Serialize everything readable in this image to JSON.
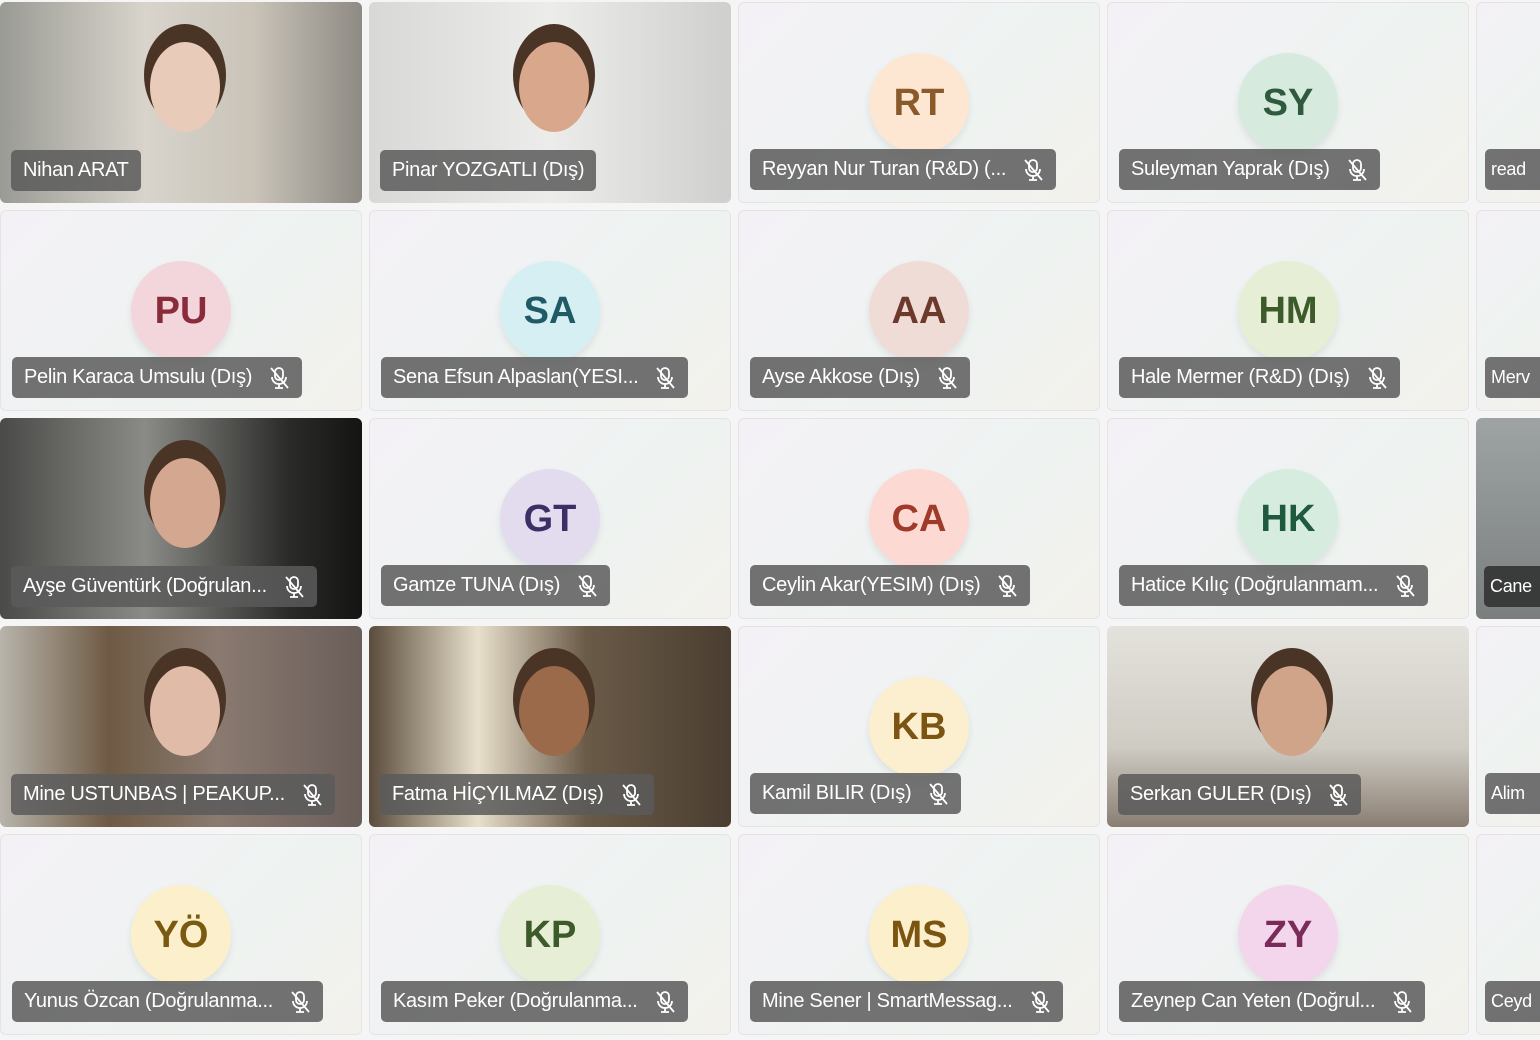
{
  "participants": [
    {
      "name": "Nihan ARAT",
      "type": "video",
      "muted": false,
      "bg": "linear-gradient(90deg,#9a9a94,#d8d4cc 40%,#c9c3b8 70%,#8e8a84)",
      "face": "#e8cbb8"
    },
    {
      "name": "Pinar YOZGATLI (Dış)",
      "type": "video",
      "muted": false,
      "bg": "linear-gradient(90deg,#d8d8d6,#ececea 50%,#cfcfcd)",
      "face": "#d9a88c"
    },
    {
      "name": "Reyyan Nur Turan (R&D) (...",
      "initials": "RT",
      "avatar_bg": "#fde7d3",
      "avatar_fg": "#8a5a2b",
      "muted": true
    },
    {
      "name": "Suleyman Yaprak (Dış)",
      "initials": "SY",
      "avatar_bg": "#d6eadd",
      "avatar_fg": "#2f5a3e",
      "muted": true
    },
    {
      "name": "read",
      "type": "blank",
      "muted": false
    },
    {
      "name": "Pelin Karaca Umsulu (Dış)",
      "initials": "PU",
      "avatar_bg": "#f3d6dc",
      "avatar_fg": "#8a2b3b",
      "muted": true
    },
    {
      "name": "Sena Efsun Alpaslan(YESI...",
      "initials": "SA",
      "avatar_bg": "#d6eff3",
      "avatar_fg": "#1f5a66",
      "muted": true
    },
    {
      "name": "Ayse Akkose (Dış)",
      "initials": "AA",
      "avatar_bg": "#f0dcd6",
      "avatar_fg": "#6b3a2b",
      "muted": true
    },
    {
      "name": "Hale Mermer (R&D) (Dış)",
      "initials": "HM",
      "avatar_bg": "#e6efd6",
      "avatar_fg": "#3d5a2a",
      "muted": true
    },
    {
      "name": "Merv",
      "type": "blank",
      "muted": false
    },
    {
      "name": "Ayşe Güventürk (Doğrulan...",
      "type": "video",
      "muted": true,
      "bg": "linear-gradient(90deg,#4a4a48,#8a8a86 40%,#2a2a28 80%,#141412)",
      "face": "#d4a890"
    },
    {
      "name": "Gamze TUNA (Dış)",
      "initials": "GT",
      "avatar_bg": "#e3dcef",
      "avatar_fg": "#3c2f66",
      "muted": true
    },
    {
      "name": "Ceylin Akar(YESIM) (Dış)",
      "initials": "CA",
      "avatar_bg": "#fcd9d3",
      "avatar_fg": "#a03a2a",
      "muted": true
    },
    {
      "name": "Hatice Kılıç (Doğrulanmam...",
      "initials": "HK",
      "avatar_bg": "#d6ecdf",
      "avatar_fg": "#1f5a3e",
      "muted": true
    },
    {
      "name": "Cane",
      "type": "video",
      "muted": false,
      "bg": "linear-gradient(180deg,#9ea3a3,#7a7e7e)"
    },
    {
      "name": "Mine USTUNBAS | PEAKUP...",
      "type": "video",
      "muted": true,
      "bg": "linear-gradient(90deg,#b8b4ac,#6e5a44 30%,#8a7a70 60%,#6a5e5a)",
      "face": "#e0bca8"
    },
    {
      "name": "Fatma HİÇYILMAZ (Dış)",
      "type": "video",
      "muted": true,
      "bg": "linear-gradient(90deg,#5a4c3c,#e8e0cc 30%,#6a5a48 60%,#4a3e30)",
      "face": "#9a6a4a"
    },
    {
      "name": "Kamil BILIR (Dış)",
      "initials": "KB",
      "avatar_bg": "#fbefcf",
      "avatar_fg": "#7a5410",
      "muted": true
    },
    {
      "name": "Serkan GULER (Dış)",
      "type": "video",
      "muted": true,
      "bg": "linear-gradient(180deg,#e4e2dc,#cfccc4 60%,#8a7e72)",
      "face": "#d0a488"
    },
    {
      "name": "Alim",
      "type": "blank",
      "muted": false
    },
    {
      "name": "Yunus Özcan (Doğrulanma...",
      "initials": "YÖ",
      "avatar_bg": "#fcf0cc",
      "avatar_fg": "#7a5a10",
      "muted": true
    },
    {
      "name": "Kasım Peker (Doğrulanma...",
      "initials": "KP",
      "avatar_bg": "#e6efd6",
      "avatar_fg": "#3d5a2a",
      "muted": true
    },
    {
      "name": "Mine Sener | SmartMessag...",
      "initials": "MS",
      "avatar_bg": "#fcefcc",
      "avatar_fg": "#7a5410",
      "muted": true
    },
    {
      "name": "Zeynep Can Yeten (Doğrul...",
      "initials": "ZY",
      "avatar_bg": "#f3d6ec",
      "avatar_fg": "#7a2b5a",
      "muted": true
    },
    {
      "name": "Ceyd",
      "type": "blank",
      "muted": false
    }
  ]
}
